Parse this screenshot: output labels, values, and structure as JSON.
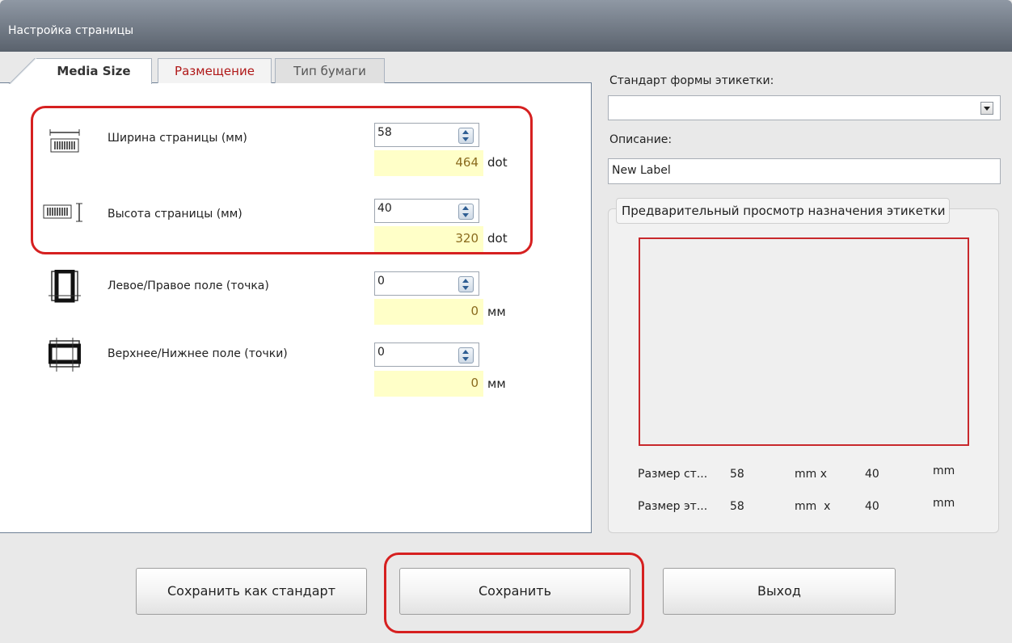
{
  "window": {
    "title": "Настройка страницы"
  },
  "tabs": [
    "Media Size",
    "Размещение",
    "Тип бумаги"
  ],
  "fields": [
    {
      "label": "Ширина страницы (мм)",
      "value": "58",
      "computed": "464",
      "unit": "dot",
      "icon": "page-width-icon"
    },
    {
      "label": "Высота страницы (мм)",
      "value": "40",
      "computed": "320",
      "unit": "dot",
      "icon": "page-height-icon"
    },
    {
      "label": "Левое/Правое поле (точка)",
      "value": "0",
      "computed": "0",
      "unit": "мм",
      "icon": "left-right-margin-icon"
    },
    {
      "label": "Верхнее/Нижнее поле (точки)",
      "value": "0",
      "computed": "0",
      "unit": "мм",
      "icon": "top-bottom-margin-icon"
    }
  ],
  "right": {
    "standard_label": "Стандарт формы этикетки:",
    "standard_value": "",
    "description_label": "Описание:",
    "description_value": "New Label",
    "preview_title": "Предварительный просмотр назначения этикетки",
    "size_rows": [
      {
        "label": "Размер ст...",
        "w": "58",
        "x": "mm x",
        "h": "40",
        "unit": "mm"
      },
      {
        "label": "Размер эт...",
        "w": "58",
        "x": "mm  x",
        "h": "40",
        "unit": "mm"
      }
    ]
  },
  "buttons": {
    "save_as_standard": "Сохранить как стандарт",
    "save": "Сохранить",
    "exit": "Выход"
  },
  "colors": {
    "highlight": "#d62020",
    "preview_border": "#c8282c",
    "computed_bg": "#ffffc8"
  }
}
